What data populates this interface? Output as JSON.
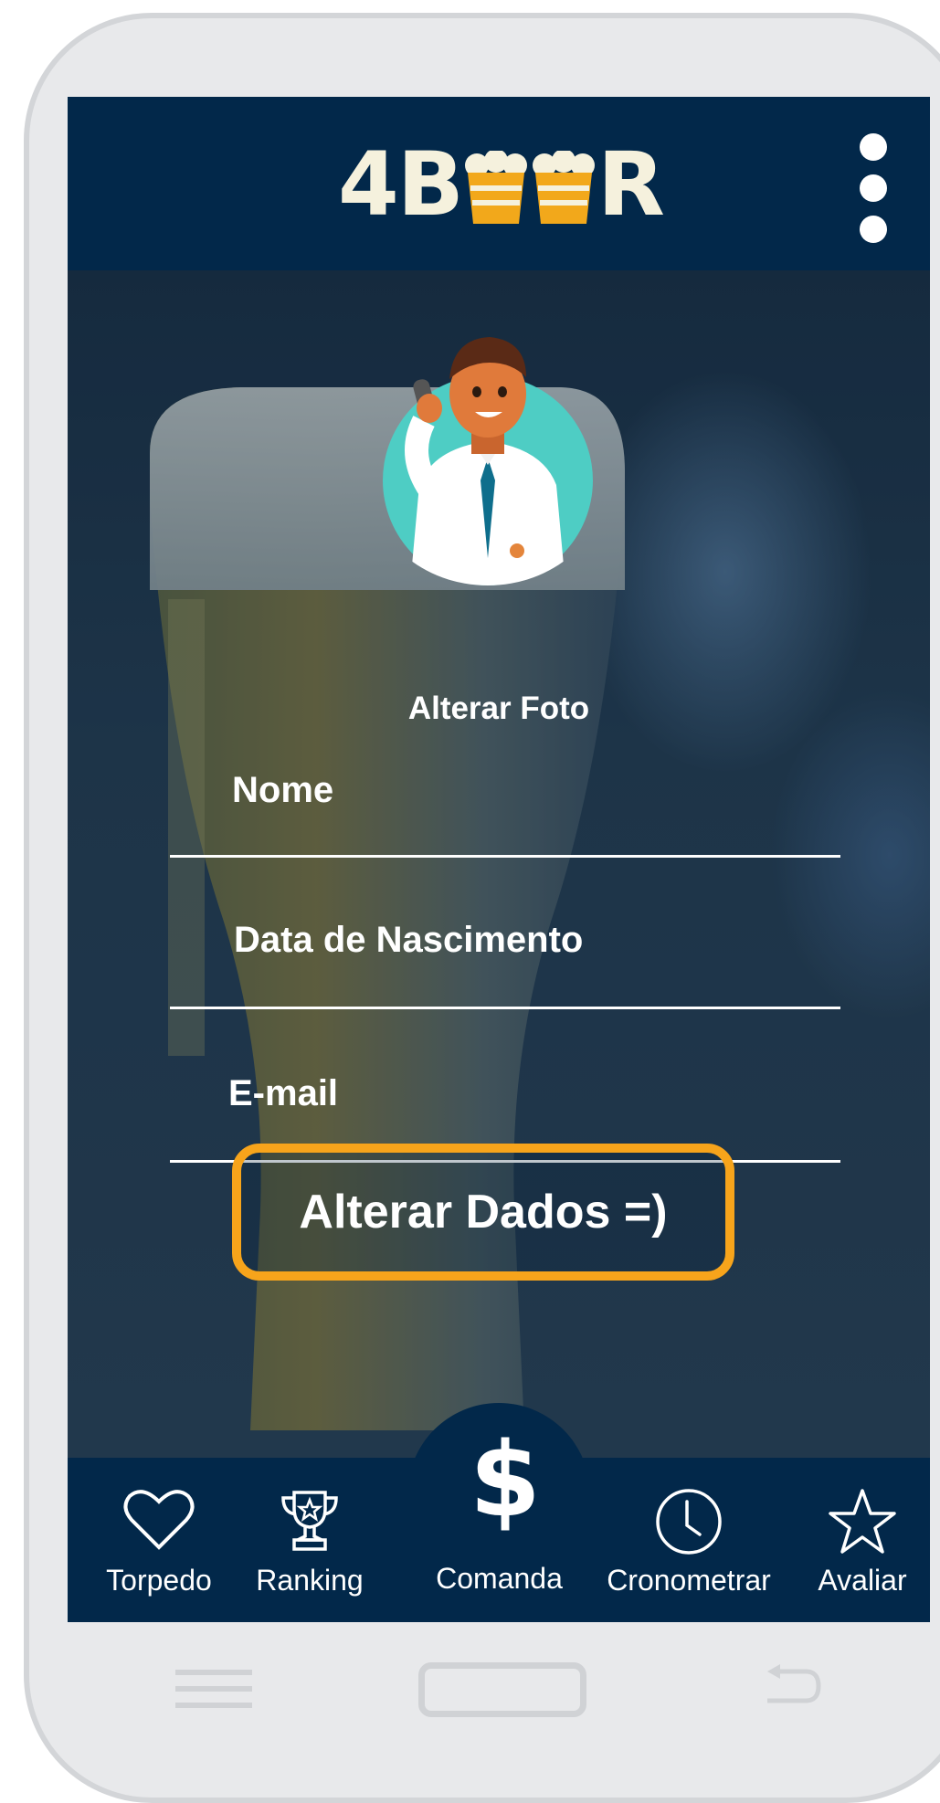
{
  "app": {
    "logo_text_left": "4B",
    "logo_text_right": "R",
    "menu_icon": "kebab-menu-icon"
  },
  "profile": {
    "change_photo_label": "Alterar Foto"
  },
  "form": {
    "name_label": "Nome",
    "birthdate_label": "Data de Nascimento",
    "email_label": "E-mail",
    "submit_label": "Alterar Dados =)"
  },
  "bottom_nav": {
    "items": [
      {
        "label": "Torpedo",
        "icon": "heart-icon"
      },
      {
        "label": "Ranking",
        "icon": "trophy-icon"
      },
      {
        "label": "Comanda",
        "icon": "dollar-icon",
        "symbol": "$"
      },
      {
        "label": "Cronometrar",
        "icon": "clock-icon"
      },
      {
        "label": "Avaliar",
        "icon": "star-icon"
      }
    ]
  },
  "colors": {
    "primary": "#02284a",
    "accent": "#f7a41b",
    "logo_cream": "#f5f1dd",
    "beer": "#f2a81b"
  }
}
